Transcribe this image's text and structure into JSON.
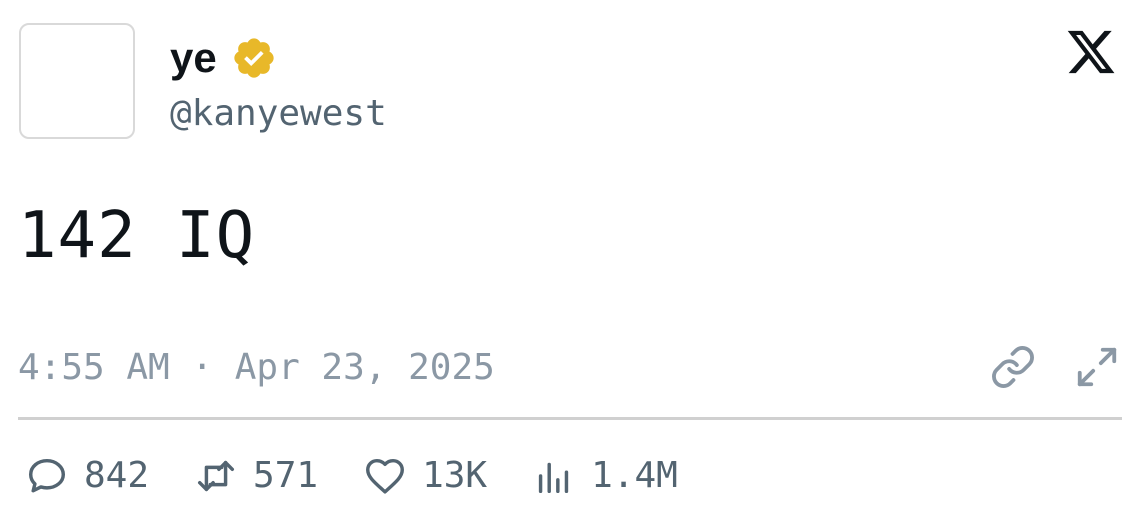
{
  "profile": {
    "display_name": "ye",
    "handle": "@kanyewest",
    "verified": true,
    "verified_color": "#e8b829"
  },
  "tweet": {
    "text": "142 IQ",
    "timestamp": "4:55 AM · Apr 23, 2025"
  },
  "stats": {
    "replies": "842",
    "retweets": "571",
    "likes": "13K",
    "views": "1.4M"
  },
  "icons": {
    "platform": "x-logo-icon",
    "verified": "verified-badge-icon",
    "link": "link-icon",
    "expand": "expand-icon",
    "reply": "reply-icon",
    "retweet": "retweet-icon",
    "like": "heart-icon",
    "views": "views-icon"
  },
  "colors": {
    "text_primary": "#0f1419",
    "text_secondary": "#536471",
    "text_muted": "#8b98a5",
    "divider": "#d0d0d0"
  }
}
